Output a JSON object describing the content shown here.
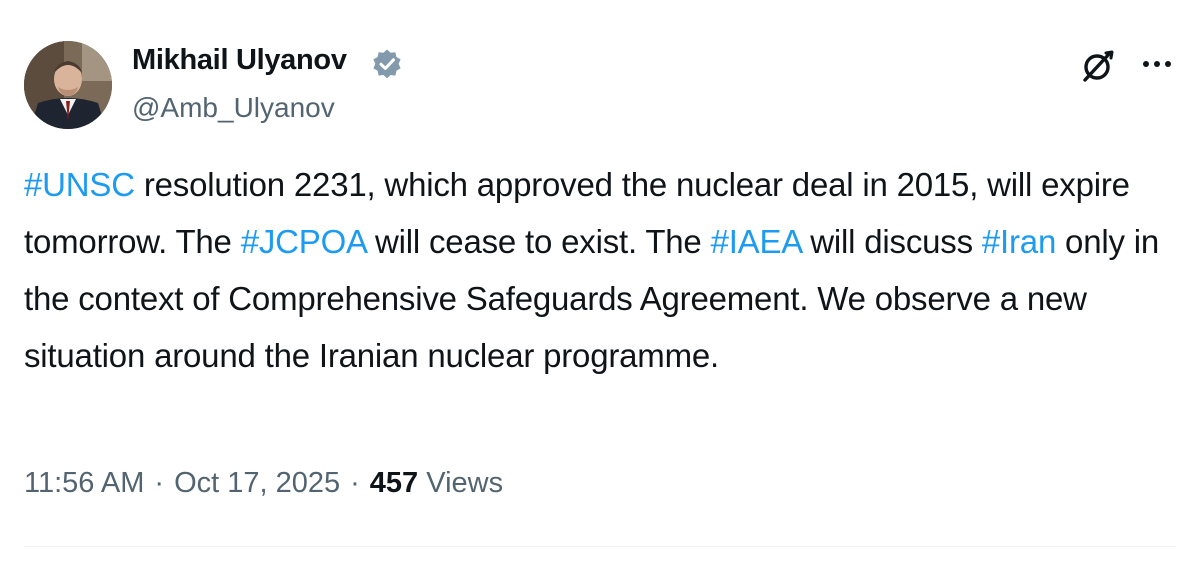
{
  "author": {
    "name": "Mikhail Ulyanov",
    "handle": "@Amb_Ulyanov"
  },
  "tweet": {
    "segments": [
      {
        "type": "hashtag",
        "text": "#UNSC"
      },
      {
        "type": "text",
        "text": " resolution 2231, which approved the nuclear deal in 2015, will expire tomorrow. The "
      },
      {
        "type": "hashtag",
        "text": "#JCPOA"
      },
      {
        "type": "text",
        "text": " will cease to exist. The "
      },
      {
        "type": "hashtag",
        "text": "#IAEA"
      },
      {
        "type": "text",
        "text": " will discuss "
      },
      {
        "type": "hashtag",
        "text": "#Iran"
      },
      {
        "type": "text",
        "text": " only in the context of Comprehensive Safeguards Agreement. We observe a new situation around the Iranian nuclear programme."
      }
    ]
  },
  "meta": {
    "time": "11:56 AM",
    "separator": "·",
    "date": "Oct 17, 2025",
    "views_count": "457",
    "views_label": "Views"
  },
  "icons": {
    "verified": "verified-badge-icon",
    "grok": "grok-icon",
    "more": "more-icon"
  },
  "colors": {
    "hashtag": "#1d9bf0",
    "secondary_text": "#536471",
    "primary_text": "#0f1419",
    "verified_badge": "#829aab"
  }
}
